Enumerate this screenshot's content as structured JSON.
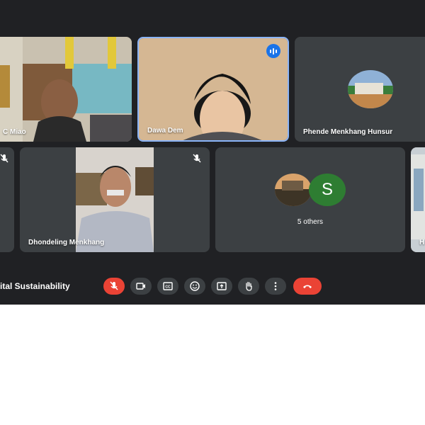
{
  "participants": [
    {
      "name": "C Miao"
    },
    {
      "name": "Dawa Dem"
    },
    {
      "name": "Phende Menkhang Hunsur"
    },
    {
      "name": "Dhondeling Menkhang"
    },
    {
      "name": "H"
    }
  ],
  "others_tile": {
    "avatar_letter": "S",
    "label": "5 others"
  },
  "meeting": {
    "title": "ital Sustainability"
  },
  "controls": [
    "mic-off",
    "camera",
    "captions",
    "reactions",
    "present",
    "raise-hand",
    "more",
    "end-call"
  ],
  "colors": {
    "background": "#202124",
    "tile": "#3c4043",
    "active_border": "#8ab4f8",
    "red": "#ea4335",
    "avatar_s": "#2e7d32"
  }
}
